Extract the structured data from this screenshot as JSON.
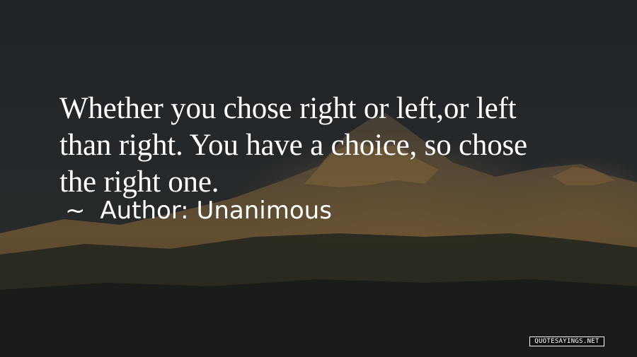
{
  "quote": {
    "lines": [
      "Whether you chose right or left,or left",
      "than right. You have a choice, so chose",
      "the right one."
    ]
  },
  "attribution": {
    "tilde": "~",
    "prefix": "Author:",
    "name": "Unanimous"
  },
  "watermark": "QUOTESAYINGS.NET",
  "colors": {
    "text": "#ffffff",
    "sky": "#202428",
    "mountain_highlight": "#8a6a3a"
  }
}
